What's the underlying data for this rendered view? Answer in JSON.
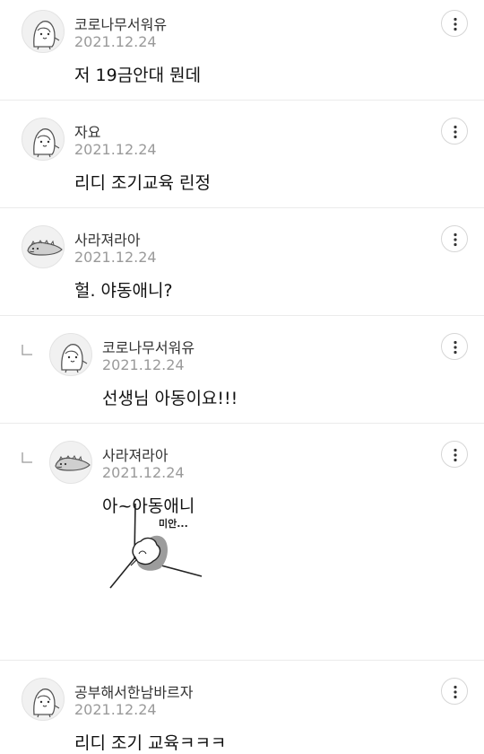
{
  "comments": [
    {
      "author": "코로나무서워유",
      "date": "2021.12.24",
      "text": "저 19금안대 뭔데",
      "avatar_icon": "penguin-avatar-icon"
    },
    {
      "author": "자요",
      "date": "2021.12.24",
      "text": "리디 조기교육 린정",
      "avatar_icon": "penguin-avatar-icon"
    },
    {
      "author": "사라져라아",
      "date": "2021.12.24",
      "text": "헐. 야동애니?",
      "avatar_icon": "lizard-avatar-icon"
    },
    {
      "author": "코로나무서워유",
      "date": "2021.12.24",
      "text": "선생님 아동이요!!!",
      "avatar_icon": "penguin-avatar-icon",
      "is_reply": true
    },
    {
      "author": "사라져라아",
      "date": "2021.12.24",
      "text": "아~아동애니",
      "avatar_icon": "lizard-avatar-icon",
      "is_reply": true,
      "sticker_text": "미안..."
    },
    {
      "author": "공부해서한남바르자",
      "date": "2021.12.24",
      "text": "리디 조기 교육ㅋㅋㅋ",
      "avatar_icon": "penguin-avatar-icon"
    }
  ],
  "icons": {
    "more": "more-vertical-icon",
    "reply": "reply-indent-icon"
  },
  "colors": {
    "text": "#111111",
    "date": "#9a9a9a",
    "divider": "#ebebeb",
    "avatar_bg": "#f1f1f1"
  }
}
